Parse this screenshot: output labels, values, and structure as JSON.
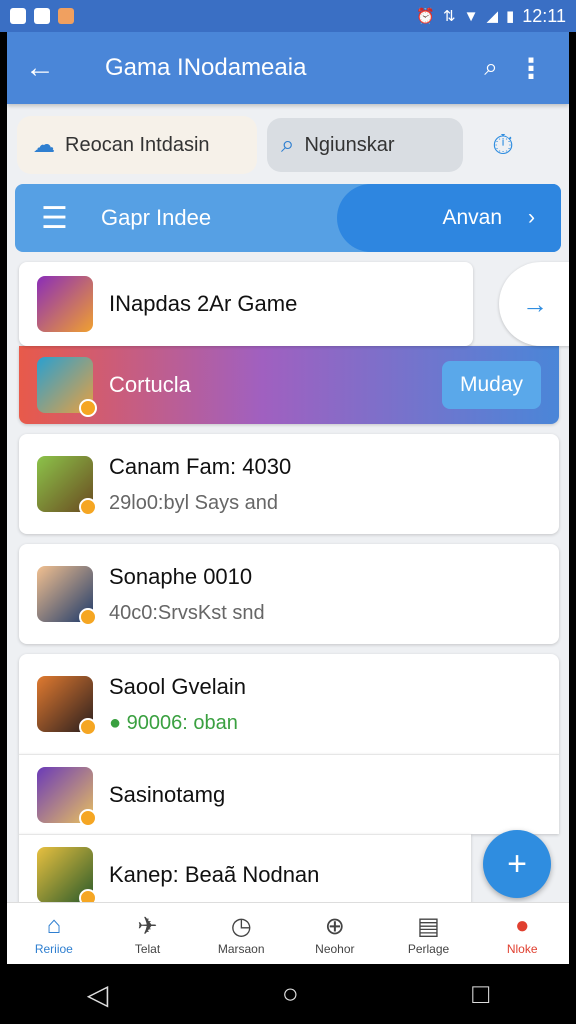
{
  "status_bar": {
    "left_icons": [
      "chat-icon",
      "gallery-icon",
      "notification-icon"
    ],
    "right_icons": [
      "alarm-icon",
      "data-icon",
      "wifi-icon",
      "signal-icon",
      "battery-icon"
    ],
    "time": "12:11"
  },
  "app_bar": {
    "title": "Gama INodameaia"
  },
  "search_row": {
    "chip_a": "Reocan Intdasin",
    "chip_b": "Ngiunskar"
  },
  "banner": {
    "title": "Gapr Indee",
    "pill_label": "Anvan"
  },
  "cards": [
    {
      "name": "INapdas 2Ar Game"
    },
    {
      "name": "Cortucla",
      "button": "Muday"
    },
    {
      "name": "Canam Fam: 4030",
      "sub": "29lo0:byl Says and"
    },
    {
      "name": "Sonaphe 0010",
      "sub": "40c0:SrvsKst snd"
    },
    {
      "name": "Saool Gvelain",
      "sub": "90006: oban",
      "sub_color": "#3aa040"
    },
    {
      "name": "Sasinotamg"
    },
    {
      "name": "Kanep: Beaã Nodnan"
    }
  ],
  "bottom_nav": [
    {
      "label": "Reriioe",
      "icon": "home-icon"
    },
    {
      "label": "Telat",
      "icon": "pin-icon"
    },
    {
      "label": "Marsaon",
      "icon": "clock-icon"
    },
    {
      "label": "Neohor",
      "icon": "plus-circle-icon"
    },
    {
      "label": "Perlage",
      "icon": "document-icon"
    },
    {
      "label": "Nloke",
      "icon": "location-icon"
    }
  ],
  "colors": {
    "primary": "#4a86d8",
    "accent": "#2f8de0",
    "status_green": "#3aa040",
    "nav_red": "#e04030"
  }
}
